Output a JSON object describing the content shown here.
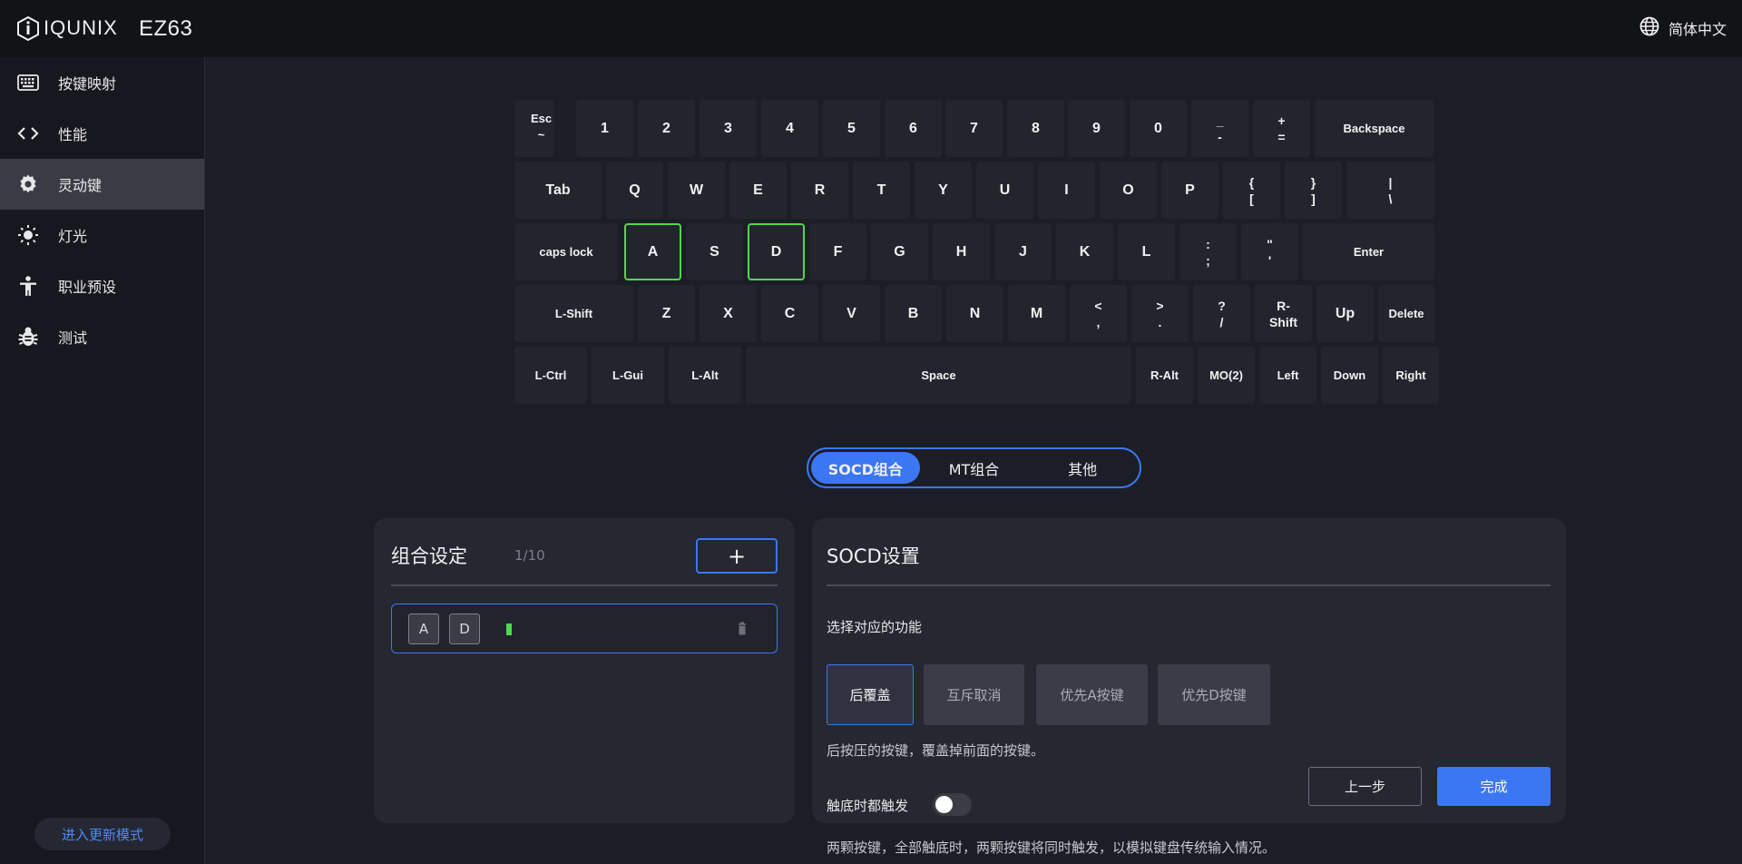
{
  "header": {
    "brand": "IQUNIX",
    "model": "EZ63",
    "language": "简体中文"
  },
  "sidebar": {
    "items": [
      {
        "label": "按键映射",
        "icon": "keyboard-icon"
      },
      {
        "label": "性能",
        "icon": "code-icon"
      },
      {
        "label": "灵动键",
        "icon": "gear-icon",
        "active": true
      },
      {
        "label": "灯光",
        "icon": "sun-icon"
      },
      {
        "label": "职业预设",
        "icon": "person-icon"
      },
      {
        "label": "测试",
        "icon": "bug-icon"
      }
    ],
    "update_mode": "进入更新模式"
  },
  "keyboard": {
    "rows": [
      [
        {
          "top": "Esc",
          "bottom": "~"
        },
        {
          "label": "1"
        },
        {
          "label": "2"
        },
        {
          "label": "3"
        },
        {
          "label": "4"
        },
        {
          "label": "5"
        },
        {
          "label": "6"
        },
        {
          "label": "7"
        },
        {
          "label": "8"
        },
        {
          "label": "9"
        },
        {
          "label": "0"
        },
        {
          "top": "_",
          "bottom": "-"
        },
        {
          "top": "+",
          "bottom": "="
        },
        {
          "label": "Backspace"
        }
      ],
      [
        {
          "label": "Tab"
        },
        {
          "label": "Q"
        },
        {
          "label": "W"
        },
        {
          "label": "E"
        },
        {
          "label": "R"
        },
        {
          "label": "T"
        },
        {
          "label": "Y"
        },
        {
          "label": "U"
        },
        {
          "label": "I"
        },
        {
          "label": "O"
        },
        {
          "label": "P"
        },
        {
          "top": "{",
          "bottom": "["
        },
        {
          "top": "}",
          "bottom": "]"
        },
        {
          "top": "|",
          "bottom": "\\"
        }
      ],
      [
        {
          "label": "caps lock"
        },
        {
          "label": "A",
          "selected": true
        },
        {
          "label": "S"
        },
        {
          "label": "D",
          "selected": true
        },
        {
          "label": "F"
        },
        {
          "label": "G"
        },
        {
          "label": "H"
        },
        {
          "label": "J"
        },
        {
          "label": "K"
        },
        {
          "label": "L"
        },
        {
          "top": ":",
          "bottom": ";"
        },
        {
          "top": "\"",
          "bottom": "'"
        },
        {
          "label": "Enter"
        }
      ],
      [
        {
          "label": "L-Shift"
        },
        {
          "label": "Z"
        },
        {
          "label": "X"
        },
        {
          "label": "C"
        },
        {
          "label": "V"
        },
        {
          "label": "B"
        },
        {
          "label": "N"
        },
        {
          "label": "M"
        },
        {
          "top": "<",
          "bottom": ","
        },
        {
          "top": ">",
          "bottom": "."
        },
        {
          "top": "?",
          "bottom": "/"
        },
        {
          "top": "R-",
          "bottom": "Shift"
        },
        {
          "label": "Up"
        },
        {
          "label": "Delete"
        }
      ],
      [
        {
          "label": "L-Ctrl"
        },
        {
          "label": "L-Gui"
        },
        {
          "label": "L-Alt"
        },
        {
          "label": "Space"
        },
        {
          "label": "R-Alt"
        },
        {
          "label": "MO(2)"
        },
        {
          "label": "Left"
        },
        {
          "label": "Down"
        },
        {
          "label": "Right"
        }
      ]
    ]
  },
  "tabs": [
    {
      "label": "SOCD组合",
      "active": true
    },
    {
      "label": "MT组合"
    },
    {
      "label": "其他"
    }
  ],
  "combo_panel": {
    "title": "组合设定",
    "count": "1/10",
    "add_label": "+",
    "combos": [
      {
        "keys": [
          "A",
          "D"
        ]
      }
    ]
  },
  "socd_panel": {
    "title": "SOCD设置",
    "select_label": "选择对应的功能",
    "options": [
      {
        "label": "后覆盖",
        "active": true
      },
      {
        "label": "互斥取消"
      },
      {
        "label": "优先A按键"
      },
      {
        "label": "优先D按键"
      }
    ],
    "description": "后按压的按键，覆盖掉前面的按键。",
    "prev_label": "上一步",
    "done_label": "完成",
    "bottom_trigger_label": "触底时都触发",
    "bottom_trigger_on": false,
    "bottom_trigger_desc": "两颗按键，全部触底时，两颗按键将同时触发，以模拟键盘传统输入情况。"
  },
  "colors": {
    "accent": "#3b77f2",
    "selected_key_border": "#4ed84e",
    "background": "#1c1e27"
  }
}
